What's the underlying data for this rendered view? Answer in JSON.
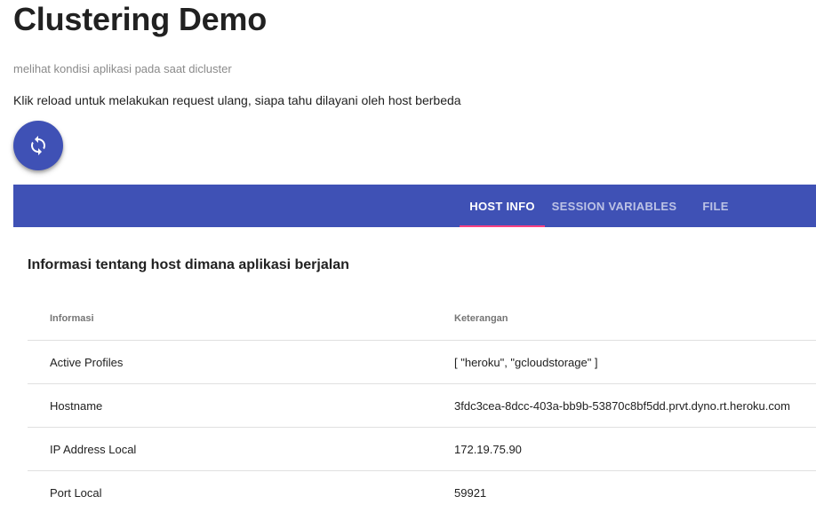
{
  "header": {
    "title": "Clustering Demo",
    "subtitle": "melihat kondisi aplikasi pada saat dicluster",
    "instruction": "Klik reload untuk melakukan request ulang, siapa tahu dilayani oleh host berbeda"
  },
  "reload_button": {
    "icon": "refresh-icon",
    "color": "#3f51b5"
  },
  "tabs": [
    {
      "label": "HOST INFO",
      "active": true
    },
    {
      "label": "SESSION VARIABLES",
      "active": false
    },
    {
      "label": "FILE",
      "active": false
    }
  ],
  "colors": {
    "primary": "#3f51b5",
    "accent": "#ff4081"
  },
  "host_info": {
    "title": "Informasi tentang host dimana aplikasi berjalan",
    "columns": [
      "Informasi",
      "Keterangan"
    ],
    "rows": [
      {
        "label": "Active Profiles",
        "value": "[ \"heroku\", \"gcloudstorage\" ]"
      },
      {
        "label": "Hostname",
        "value": "3fdc3cea-8dcc-403a-bb9b-53870c8bf5dd.prvt.dyno.rt.heroku.com"
      },
      {
        "label": "IP Address Local",
        "value": "172.19.75.90"
      },
      {
        "label": "Port Local",
        "value": "59921"
      }
    ]
  }
}
